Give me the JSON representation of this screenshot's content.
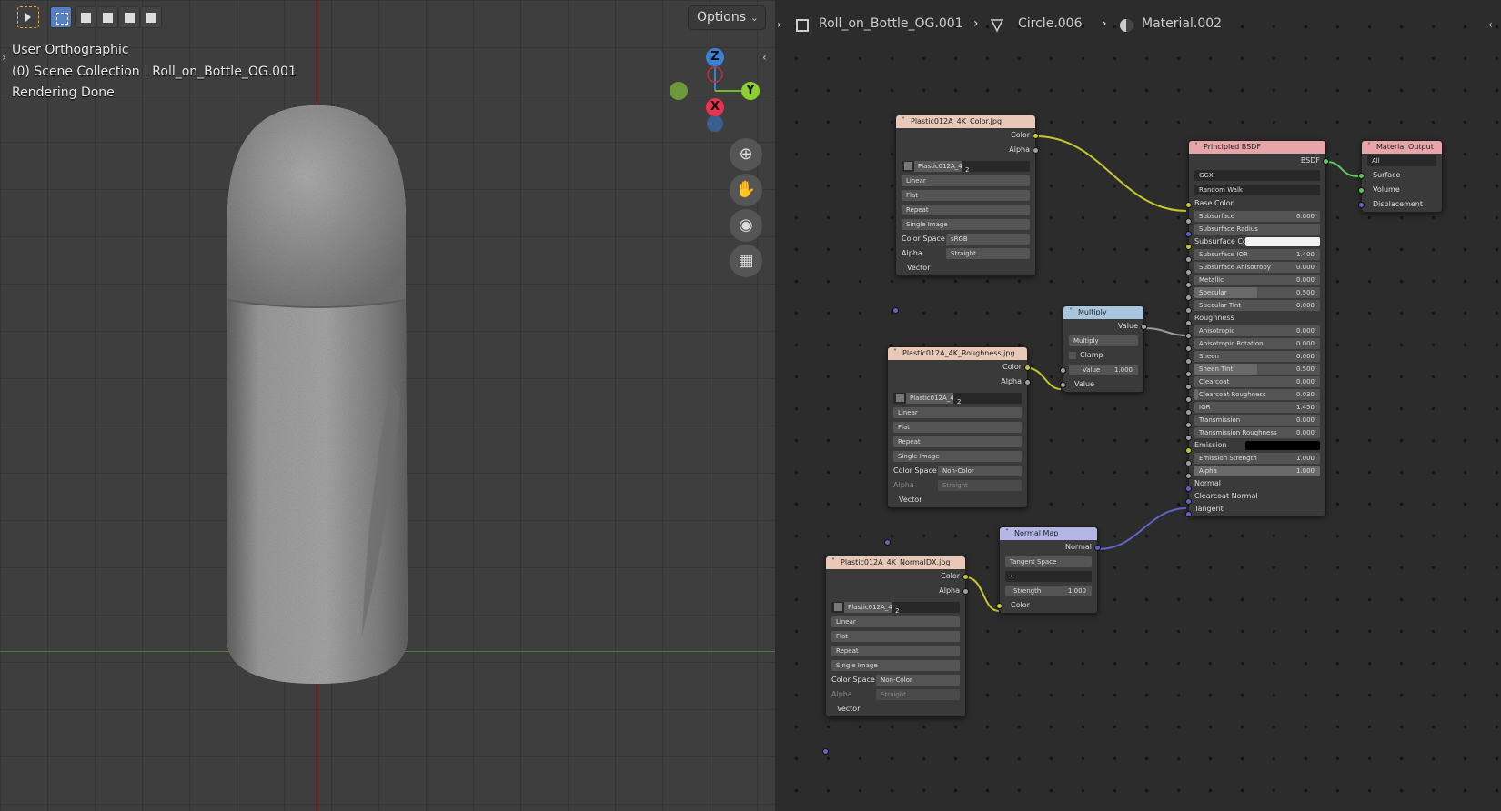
{
  "viewport": {
    "options_label": "Options",
    "view_name": "User Orthographic",
    "collection_line": "(0) Scene Collection | Roll_on_Bottle_OG.001",
    "status": "Rendering Done",
    "gizmo": {
      "z": "Z",
      "x": "X",
      "y": "Y"
    },
    "nav_icons": [
      "zoom-icon",
      "hand-icon",
      "camera-icon",
      "grid-icon"
    ]
  },
  "breadcrumb": {
    "object": "Roll_on_Bottle_OG.001",
    "mesh": "Circle.006",
    "material": "Material.002"
  },
  "nodes": {
    "color_tex": {
      "title": "Plastic012A_4K_Color.jpg",
      "out_color": "Color",
      "out_alpha": "Alpha",
      "image_name": "Plastic012A_4...",
      "users": "2",
      "interp": "Linear",
      "proj": "Flat",
      "ext": "Repeat",
      "src": "Single Image",
      "cs_label": "Color Space",
      "cs_value": "sRGB",
      "alpha_label": "Alpha",
      "alpha_value": "Straight",
      "vector": "Vector"
    },
    "rough_tex": {
      "title": "Plastic012A_4K_Roughness.jpg",
      "out_color": "Color",
      "out_alpha": "Alpha",
      "image_name": "Plastic012A_4...",
      "users": "2",
      "interp": "Linear",
      "proj": "Flat",
      "ext": "Repeat",
      "src": "Single Image",
      "cs_label": "Color Space",
      "cs_value": "Non-Color",
      "alpha_label": "Alpha",
      "alpha_value": "Straight",
      "vector": "Vector"
    },
    "normal_tex": {
      "title": "Plastic012A_4K_NormalDX.jpg",
      "out_color": "Color",
      "out_alpha": "Alpha",
      "image_name": "Plastic012A_4...",
      "users": "2",
      "interp": "Linear",
      "proj": "Flat",
      "ext": "Repeat",
      "src": "Single Image",
      "cs_label": "Color Space",
      "cs_value": "Non-Color",
      "alpha_label": "Alpha",
      "alpha_value": "Straight",
      "vector": "Vector"
    },
    "multiply": {
      "title": "Multiply",
      "out": "Value",
      "op": "Multiply",
      "clamp": "Clamp",
      "value_label": "Value",
      "value": "1.000",
      "in": "Value"
    },
    "normal_map": {
      "title": "Normal Map",
      "out": "Normal",
      "space": "Tangent Space",
      "uv": "•",
      "strength_label": "Strength",
      "strength": "1.000",
      "in": "Color"
    },
    "bsdf": {
      "title": "Principled BSDF",
      "out": "BSDF",
      "distribution": "GGX",
      "subsurface_method": "Random Walk",
      "base_color": "Base Color",
      "params": [
        {
          "label": "Subsurface",
          "value": "0.000",
          "fill": 0
        },
        {
          "label": "Subsurface Radius",
          "value": "",
          "fill": 0
        },
        {
          "label": "Subsurface Color",
          "value": "",
          "fill": 0,
          "swatch": "#f2f2f2"
        },
        {
          "label": "Subsurface IOR",
          "value": "1.400",
          "fill": 0
        },
        {
          "label": "Subsurface Anisotropy",
          "value": "0.000",
          "fill": 0
        },
        {
          "label": "Metallic",
          "value": "0.000",
          "fill": 0
        },
        {
          "label": "Specular",
          "value": "0.500",
          "fill": 0.5
        },
        {
          "label": "Specular Tint",
          "value": "0.000",
          "fill": 0
        },
        {
          "label": "Roughness",
          "value": "",
          "fill": 0,
          "socket_only": true
        },
        {
          "label": "Anisotropic",
          "value": "0.000",
          "fill": 0
        },
        {
          "label": "Anisotropic Rotation",
          "value": "0.000",
          "fill": 0
        },
        {
          "label": "Sheen",
          "value": "0.000",
          "fill": 0
        },
        {
          "label": "Sheen Tint",
          "value": "0.500",
          "fill": 0.5
        },
        {
          "label": "Clearcoat",
          "value": "0.000",
          "fill": 0
        },
        {
          "label": "Clearcoat Roughness",
          "value": "0.030",
          "fill": 0.03
        },
        {
          "label": "IOR",
          "value": "1.450",
          "fill": 0
        },
        {
          "label": "Transmission",
          "value": "0.000",
          "fill": 0
        },
        {
          "label": "Transmission Roughness",
          "value": "0.000",
          "fill": 0
        },
        {
          "label": "Emission",
          "value": "",
          "fill": 0,
          "swatch": "#000000"
        },
        {
          "label": "Emission Strength",
          "value": "1.000",
          "fill": 0
        },
        {
          "label": "Alpha",
          "value": "1.000",
          "fill": 1
        },
        {
          "label": "Normal",
          "value": "",
          "fill": 0,
          "socket_only": true
        },
        {
          "label": "Clearcoat Normal",
          "value": "",
          "fill": 0,
          "socket_only": true
        },
        {
          "label": "Tangent",
          "value": "",
          "fill": 0,
          "socket_only": true
        }
      ]
    },
    "output": {
      "title": "Material Output",
      "target": "All",
      "surface": "Surface",
      "volume": "Volume",
      "displacement": "Displacement"
    }
  }
}
